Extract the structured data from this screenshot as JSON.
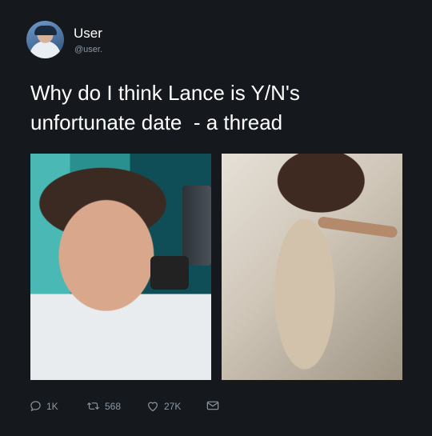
{
  "author": {
    "name": "User",
    "handle": "@user."
  },
  "tweet": {
    "text": "Why do I think Lance is Y/N's\nunfortunate date  - a thread"
  },
  "media": [
    {
      "alt": "",
      "icon": "photo-driver"
    },
    {
      "alt": "",
      "icon": "photo-dress"
    }
  ],
  "actions": {
    "reply_count": "1K",
    "retweet_count": "568",
    "like_count": "27K"
  },
  "colors": {
    "background": "#15181c",
    "text": "#ffffff",
    "muted": "#8b98a5"
  }
}
